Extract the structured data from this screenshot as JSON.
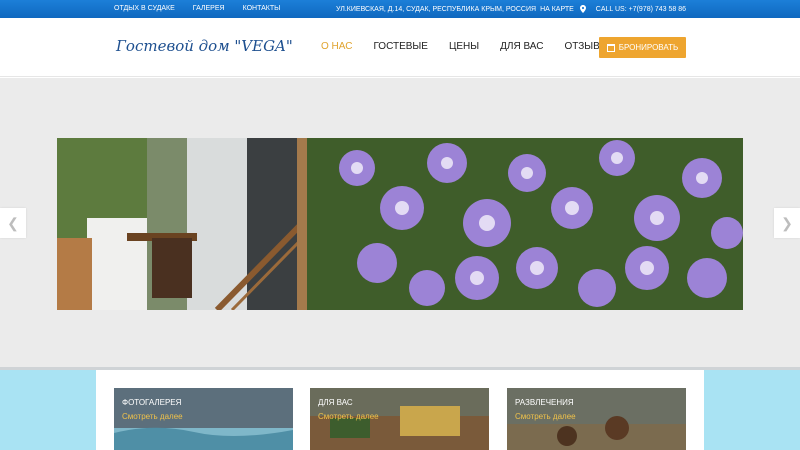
{
  "topbar": {
    "links": [
      "Отдых в Судаке",
      "Галерея",
      "Контакты"
    ],
    "address": "ул.Киевская, д.14, Судак, Республика Крым, Россия",
    "map_link": "на карте",
    "phone": "CALL US: +7(978) 743 58 86",
    "map_icon": "map-pin-icon"
  },
  "header": {
    "logo": "Гостевой дом \"VEGA\"",
    "nav": [
      "О нас",
      "Гостевые",
      "Цены",
      "Для Вас",
      "Отзывы"
    ],
    "nav_active_index": 0,
    "book_label": "Бронировать",
    "book_icon": "calendar-icon"
  },
  "slider": {
    "prev_icon": "chevron-left-icon",
    "next_icon": "chevron-right-icon",
    "dots_count": 3
  },
  "features": [
    {
      "title": "Фотогалерея",
      "more": "Смотреть далее"
    },
    {
      "title": "Для Вас",
      "more": "Смотреть далее"
    },
    {
      "title": "Развлечения",
      "more": "Смотреть далее"
    }
  ],
  "colors": {
    "topbar": "#1c7fd8",
    "accent": "#eea52f",
    "features_bg": "#a9e3f3"
  }
}
